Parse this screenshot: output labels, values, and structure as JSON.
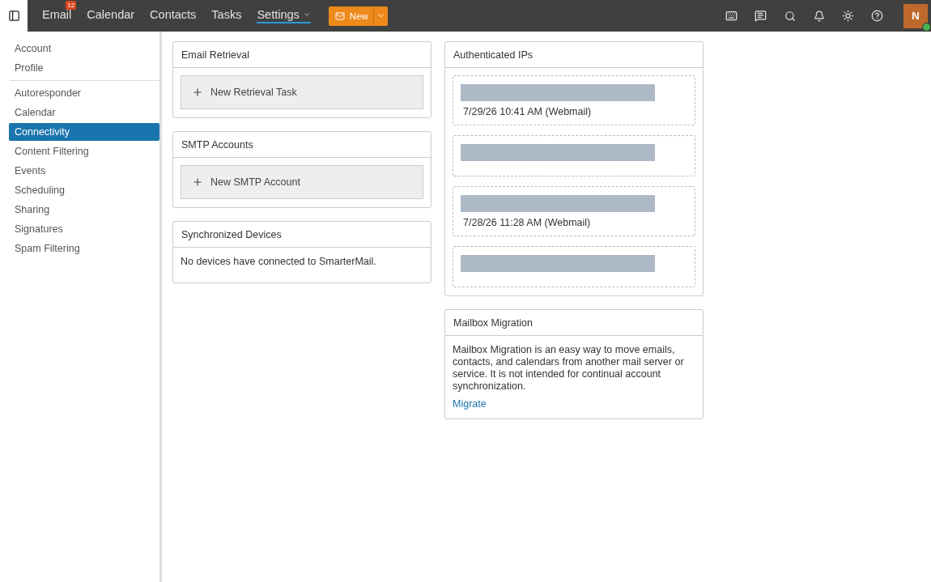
{
  "nav": {
    "items": [
      {
        "label": "Email",
        "badge": "12",
        "selected": false,
        "dropdown": false
      },
      {
        "label": "Calendar",
        "selected": false,
        "dropdown": false
      },
      {
        "label": "Contacts",
        "selected": false,
        "dropdown": false
      },
      {
        "label": "Tasks",
        "selected": false,
        "dropdown": false
      },
      {
        "label": "Settings",
        "selected": true,
        "dropdown": true
      }
    ],
    "new_button": "New",
    "avatar": "N",
    "online": true
  },
  "sidebar": {
    "groups": [
      [
        {
          "label": "Account",
          "selected": false
        },
        {
          "label": "Profile",
          "selected": false
        }
      ],
      [
        {
          "label": "Autoresponder",
          "selected": false
        },
        {
          "label": "Calendar",
          "selected": false
        },
        {
          "label": "Connectivity",
          "selected": true
        },
        {
          "label": "Content Filtering",
          "selected": false
        },
        {
          "label": "Events",
          "selected": false
        },
        {
          "label": "Scheduling",
          "selected": false
        },
        {
          "label": "Sharing",
          "selected": false
        },
        {
          "label": "Signatures",
          "selected": false
        },
        {
          "label": "Spam Filtering",
          "selected": false
        }
      ]
    ]
  },
  "left_cards": [
    {
      "title": "Email Retrieval",
      "kind": "action",
      "action": "New Retrieval Task"
    },
    {
      "title": "SMTP Accounts",
      "kind": "action",
      "action": "New SMTP Account"
    },
    {
      "title": "Synchronized Devices",
      "kind": "text",
      "text": "No devices have connected to SmarterMail."
    }
  ],
  "authenticated_ips": {
    "title": "Authenticated IPs",
    "entries": [
      {
        "redacted": true,
        "lines": [
          "7/29/26 10:41 AM (Webmail)"
        ]
      },
      {
        "redacted": true
      },
      {
        "redacted": true,
        "lines": [
          "7/28/26 11:28 AM (Webmail)"
        ]
      },
      {
        "redacted": true
      }
    ]
  },
  "mailbox_migration": {
    "title": "Mailbox Migration",
    "text": "Mailbox Migration is an easy way to move emails, contacts, and calendars from another mail server or service. It is not intended for continual account synchronization.",
    "link": "Migrate"
  }
}
